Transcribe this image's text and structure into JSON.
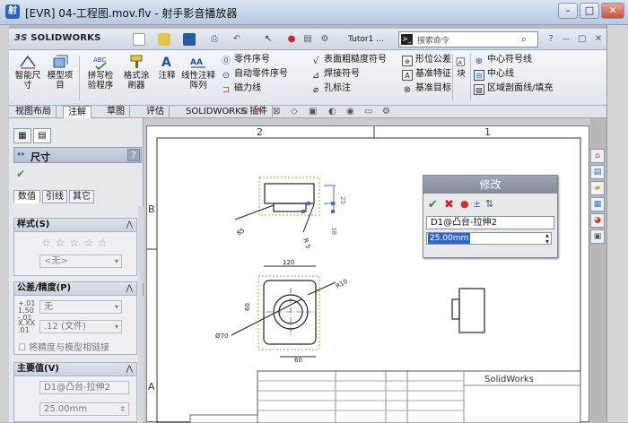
{
  "window": {
    "title": "[EVR] 04-工程图.mov.flv - 射手影音播放器"
  },
  "toolbar": {
    "brand": "SOLIDWORKS",
    "brand_prefix": "3S",
    "doc_name": "Tutor1 ...",
    "search_placeholder": "搜索命令"
  },
  "ribbon": {
    "big_buttons": [
      {
        "label": "智能尺寸",
        "icon": "smart-dimension-icon"
      },
      {
        "label": "模型项目",
        "icon": "model-items-icon"
      },
      {
        "label": "拼写检验程序",
        "icon": "spell-check-icon"
      },
      {
        "label": "格式涂刷器",
        "icon": "format-painter-icon"
      },
      {
        "label": "注释",
        "icon": "note-icon"
      },
      {
        "label": "线性注释阵列",
        "icon": "linear-pattern-icon"
      }
    ],
    "col1": [
      "零件序号",
      "自动零件序号",
      "磁力线"
    ],
    "col2": [
      "表面粗糙度符号",
      "焊接符号",
      "孔标注"
    ],
    "col3": [
      "形位公差",
      "基准特征",
      "基准目标"
    ],
    "block_label": "块",
    "col4": [
      "中心符号线",
      "中心线",
      "区域剖面线/填充"
    ]
  },
  "tabs": [
    "视图布局",
    "注解",
    "草图",
    "评估",
    "SOLIDWORKS 插件"
  ],
  "active_tab": "注解",
  "panel": {
    "title": "尺寸",
    "help": "?",
    "subtabs": [
      "数值",
      "引线",
      "其它"
    ],
    "style_group": {
      "title": "样式(S)",
      "value": "<无>"
    },
    "tol_group": {
      "title": "公差/精度(P)",
      "tol_value": "无",
      "precision_value": ".12 (文件)",
      "link_checkbox": "将精度与模型相链接",
      "icon_label_1": "+.01 1.50 -.01",
      "icon_label_2": "X.XX .01"
    },
    "primary_group": {
      "title": "主要值(V)",
      "name": "D1@凸台-拉伸2",
      "value": "25.00mm"
    }
  },
  "sheet": {
    "zone_top": [
      "2",
      "1"
    ],
    "zone_side": [
      "B",
      "A"
    ],
    "title_block_company": "SolidWorks"
  },
  "drawing_dims": {
    "d25": "25",
    "d85": "85",
    "r5": "R 5",
    "v38": "38",
    "d120": "120",
    "r10": "R10",
    "d60a": "60",
    "d60b": "60",
    "phi70": "Ø70"
  },
  "modify_dialog": {
    "title": "修改",
    "dim_name": "D1@凸台-拉伸2",
    "value": "25.00mm"
  },
  "colors": {
    "ribbon_bg": "#e2e6ec",
    "dialog_head": "#8e96a4",
    "selection_orange": "#e08a1e",
    "dim_blue": "#3f6fc6"
  }
}
